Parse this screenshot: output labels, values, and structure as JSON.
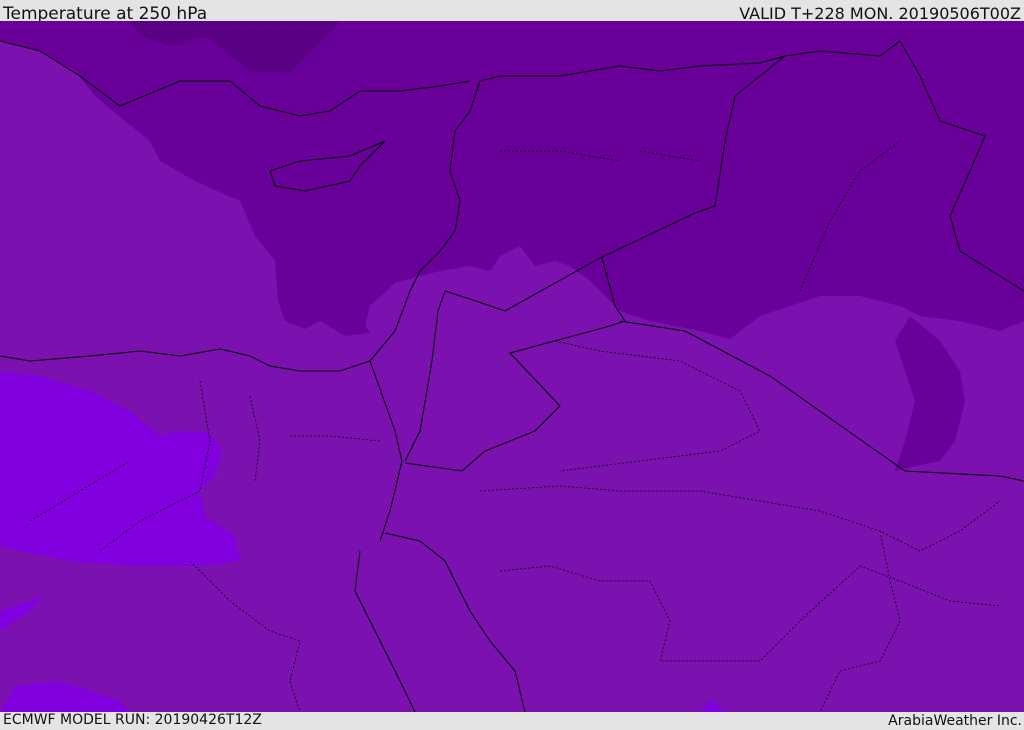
{
  "header": {
    "title": "Temperature at 250 hPa",
    "valid": "VALID T+228 MON. 20190506T00Z"
  },
  "footer": {
    "model_run": "ECMWF MODEL RUN: 20190426T12Z",
    "credit": "ArabiaWeather Inc."
  },
  "colors": {
    "base": "#7b12b0",
    "cold": "#680099",
    "colder": "#5a0085",
    "warm": "#8200e0",
    "background": "#e4e4e4",
    "border": "#000000"
  }
}
